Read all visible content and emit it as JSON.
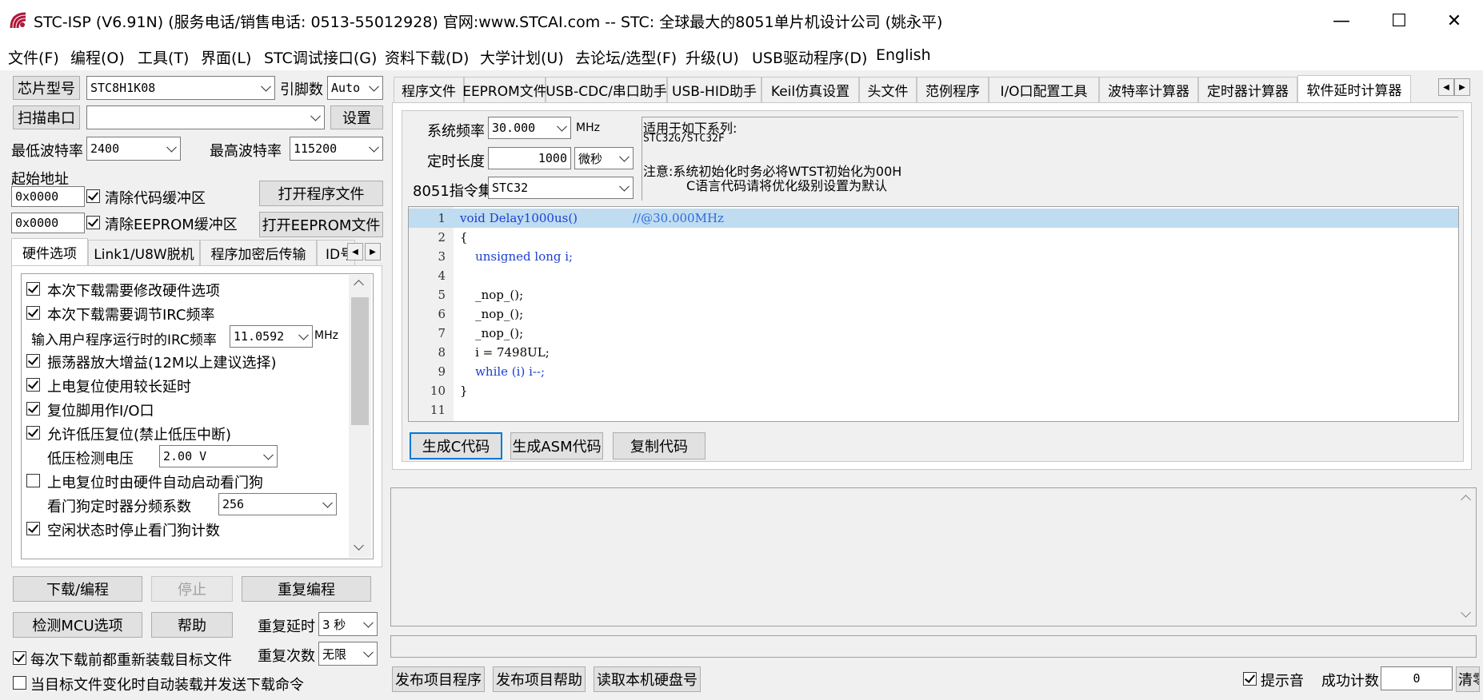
{
  "window": {
    "title": "STC-ISP (V6.91N) (服务电话/销售电话: 0513-55012928) 官网:www.STCAI.com  -- STC: 全球最大的8051单片机设计公司 (姚永平)",
    "minimize": "—",
    "maximize": "☐",
    "close": "✕"
  },
  "menu": [
    "文件(F)",
    "编程(O)",
    "工具(T)",
    "界面(L)",
    "STC调试接口(G)",
    "资料下载(D)",
    "大学计划(U)",
    "去论坛/选型(F)",
    "升级(U)",
    "USB驱动程序(D)",
    "English"
  ],
  "left": {
    "chip_label": "芯片型号",
    "chip_value": "STC8H1K08",
    "pins_label": "引脚数",
    "pins_value": "Auto",
    "scan_label": "扫描串口",
    "port_value": "",
    "settings_label": "设置",
    "min_baud_label": "最低波特率",
    "min_baud_value": "2400",
    "max_baud_label": "最高波特率",
    "max_baud_value": "115200",
    "start_addr_label": "起始地址",
    "addr1": "0x0000",
    "clear_code_label": "清除代码缓冲区",
    "open_prog_label": "打开程序文件",
    "addr2": "0x0000",
    "clear_eeprom_label": "清除EEPROM缓冲区",
    "open_eeprom_label": "打开EEPROM文件",
    "tabs": [
      "硬件选项",
      "Link1/U8W脱机",
      "程序加密后传输",
      "ID号"
    ],
    "options": {
      "opt1": "本次下载需要修改硬件选项",
      "opt2": "本次下载需要调节IRC频率",
      "irc_label": "输入用户程序运行时的IRC频率",
      "irc_value": "11.0592",
      "irc_unit": "MHz",
      "opt3": "振荡器放大增益(12M以上建议选择)",
      "opt4": "上电复位使用较长延时",
      "opt5": "复位脚用作I/O口",
      "opt6": "允许低压复位(禁止低压中断)",
      "lv_label": "低压检测电压",
      "lv_value": "2.00 V",
      "opt7": "上电复位时由硬件自动启动看门狗",
      "wdt_label": "看门狗定时器分频系数",
      "wdt_value": "256",
      "opt8": "空闲状态时停止看门狗计数"
    },
    "download_label": "下载/编程",
    "stop_label": "停止",
    "reprogram_label": "重复编程",
    "detect_label": "检测MCU选项",
    "help_label": "帮助",
    "repeat_delay_label": "重复延时",
    "repeat_delay_value": "3 秒",
    "repeat_count_label": "重复次数",
    "repeat_count_value": "无限",
    "reload_label": "每次下载前都重新装载目标文件",
    "auto_load_label": "当目标文件变化时自动装载并发送下载命令"
  },
  "right": {
    "tabs": [
      "程序文件",
      "EEPROM文件",
      "USB-CDC/串口助手",
      "USB-HID助手",
      "Keil仿真设置",
      "头文件",
      "范例程序",
      "I/O口配置工具",
      "波特率计算器",
      "定时器计算器",
      "软件延时计算器"
    ],
    "sysfreq_label": "系统频率",
    "sysfreq_value": "30.000",
    "sysfreq_unit": "MHz",
    "delay_label": "定时长度",
    "delay_value": "1000",
    "delay_unit": "微秒",
    "isa_label": "8051指令集",
    "isa_value": "STC32",
    "note_line1": "适用于如下系列:",
    "note_line2": "STC32G/STC32F",
    "note_line3": "注意:系统初始化时务必将WTST初始化为00H",
    "note_line4": "C语言代码请将优化级别设置为默认",
    "code_lines": [
      {
        "n": "1",
        "text": "void Delay1000us()",
        "comment": "//@30.000MHz"
      },
      {
        "n": "2",
        "text": "{"
      },
      {
        "n": "3",
        "text": "    unsigned long i;"
      },
      {
        "n": "4",
        "text": ""
      },
      {
        "n": "5",
        "text": "    _nop_();"
      },
      {
        "n": "6",
        "text": "    _nop_();"
      },
      {
        "n": "7",
        "text": "    _nop_();"
      },
      {
        "n": "8",
        "text": "    i = 7498UL;"
      },
      {
        "n": "9",
        "text": "    while (i) i--;"
      },
      {
        "n": "10",
        "text": "}"
      },
      {
        "n": "11",
        "text": ""
      }
    ],
    "gen_c_label": "生成C代码",
    "gen_asm_label": "生成ASM代码",
    "copy_label": "复制代码"
  },
  "bottom": {
    "publish_prog_label": "发布项目程序",
    "publish_help_label": "发布项目帮助",
    "read_disk_label": "读取本机硬盘号",
    "beep_label": "提示音",
    "success_label": "成功计数",
    "success_value": "0",
    "clear_label": "清零"
  }
}
